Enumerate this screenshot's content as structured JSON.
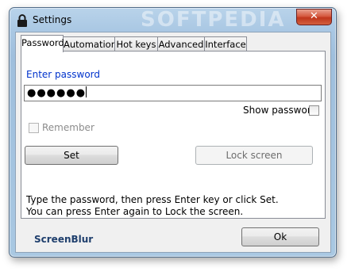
{
  "window": {
    "title": "Settings",
    "watermark": "SOFTPEDIA",
    "close_glyph": "✕"
  },
  "tabs": [
    {
      "label": "Password"
    },
    {
      "label": "Automation"
    },
    {
      "label": "Hot keys"
    },
    {
      "label": "Advanced"
    },
    {
      "label": "Interface"
    }
  ],
  "password": {
    "prompt": "Enter password",
    "value_masked": "●●●●●●",
    "show_password_label": "Show password",
    "remember_label": "Remember",
    "set_button": "Set",
    "lock_button": "Lock screen",
    "hint_line1": "Type the password, then press Enter key or click Set.",
    "hint_line2": "You can press Enter again to Lock the screen."
  },
  "footer": {
    "brand": "ScreenBlur",
    "ok_button": "Ok"
  }
}
